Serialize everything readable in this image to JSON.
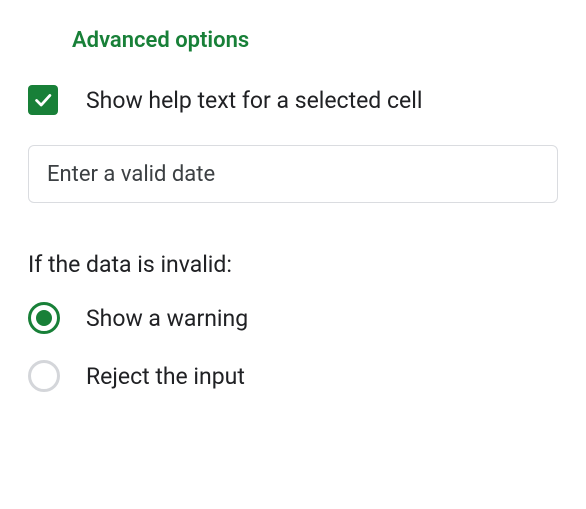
{
  "section": {
    "title": "Advanced options"
  },
  "help_text": {
    "checkbox_checked": true,
    "label": "Show help text for a selected cell",
    "input_value": "Enter a valid date",
    "input_placeholder": ""
  },
  "invalid_data": {
    "heading": "If the data is invalid:",
    "options": [
      {
        "label": "Show a warning",
        "selected": true
      },
      {
        "label": "Reject the input",
        "selected": false
      }
    ]
  },
  "colors": {
    "accent": "#188038"
  }
}
